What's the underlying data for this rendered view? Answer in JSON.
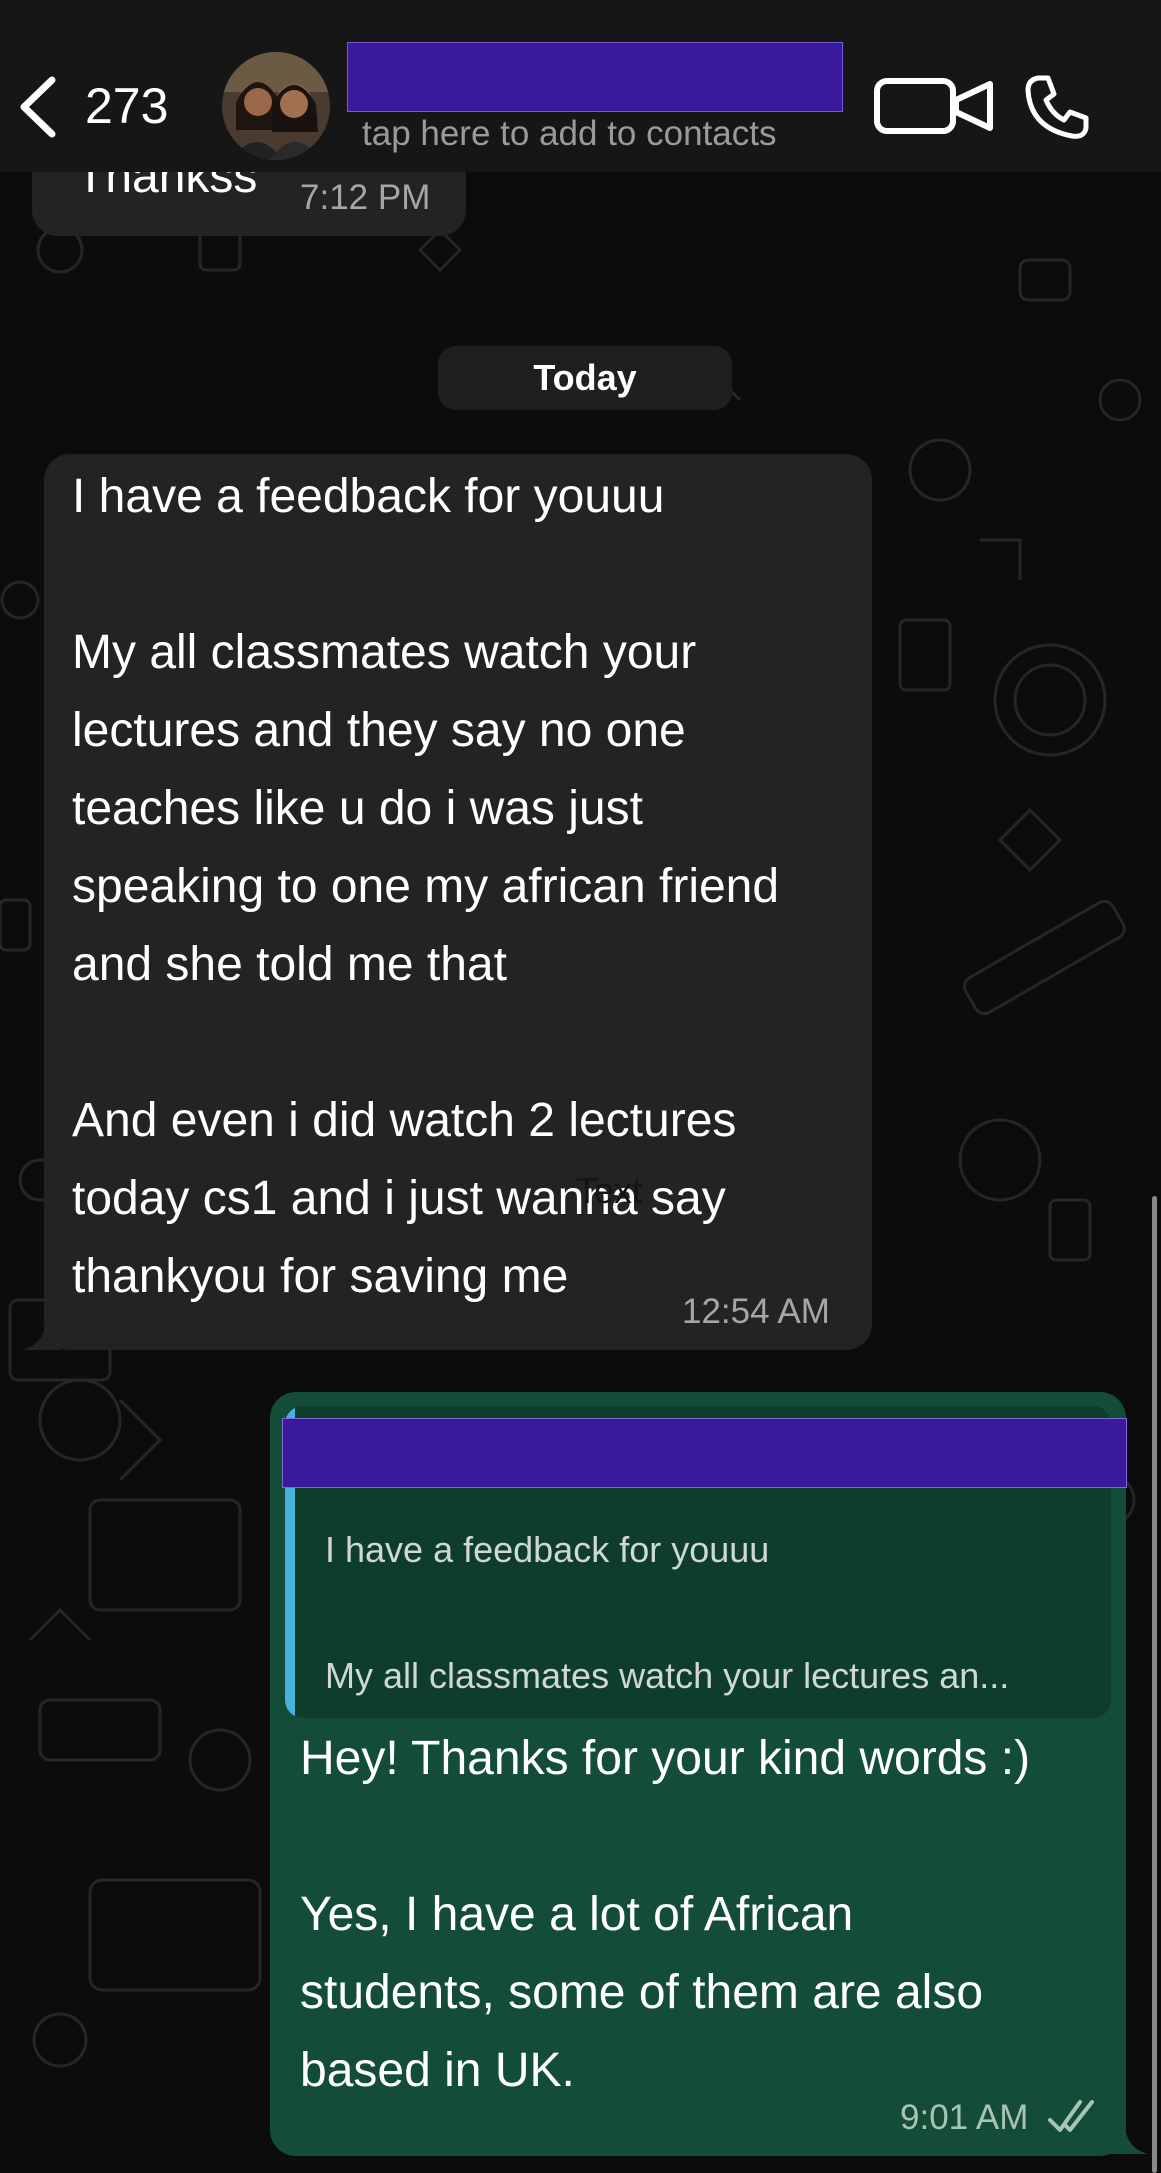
{
  "header": {
    "back_count": "273",
    "subtitle": "tap here to add to contacts",
    "icons": {
      "back": "chevron-left-icon",
      "video": "video-camera-icon",
      "call": "phone-icon"
    }
  },
  "colors": {
    "header_bg": "#161616",
    "incoming_bubble": "#232323",
    "outgoing_bubble": "#144d37",
    "quote_bar": "#47b3da",
    "redaction": "#3a1a9b"
  },
  "chat": {
    "prev_message": {
      "text": "Thankss",
      "time": "7:12 PM"
    },
    "date_divider": "Today",
    "incoming": {
      "lines": [
        "I have a feedback for youuu",
        "",
        "My all classmates watch your",
        "lectures and they say no one",
        "teaches like u do i was just",
        "speaking to one my african friend",
        "and she told me that",
        "",
        "And even i did watch 2 lectures",
        "today cs1 and i just wanna say",
        "thankyou for saving me"
      ],
      "time": "12:54 AM"
    },
    "overlay_label": "Text",
    "outgoing": {
      "quote_lines": [
        "I have a feedback for youuu",
        "My all classmates watch your lectures an..."
      ],
      "lines": [
        "Hey! Thanks for your kind words :)",
        "",
        "Yes, I have a lot of African",
        "students, some of them are also",
        "based in UK."
      ],
      "time": "9:01 AM",
      "status_icon": "double-check-icon"
    }
  }
}
